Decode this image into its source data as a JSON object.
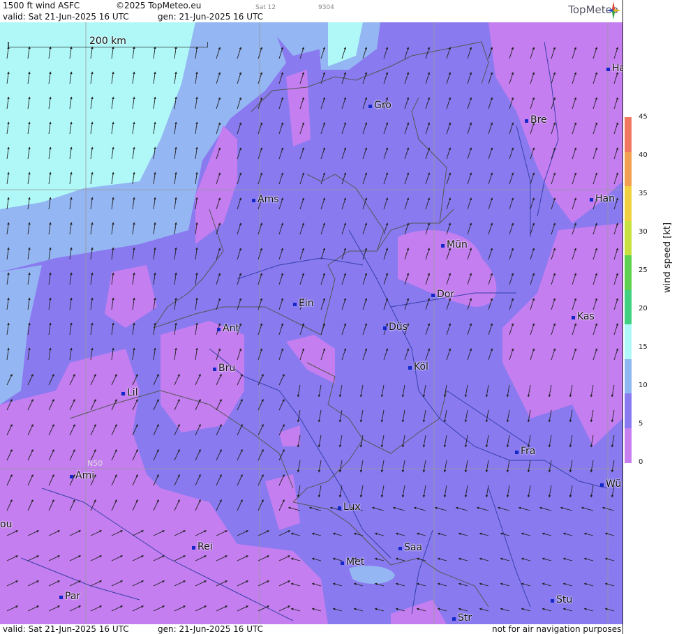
{
  "header": {
    "title": "1500 ft wind ASFC",
    "copyright": "©2025 TopMeteo.eu",
    "valid": "valid:  Sat  21-Jun-2025  16 UTC",
    "generated": "gen: 21-Jun-2025 16 UTC",
    "run_label": "Sat 12",
    "code": "9304",
    "logo": "TopMeteo"
  },
  "footer": {
    "valid": "valid:  Sat  21-Jun-2025  16 UTC",
    "generated": "gen: 21-Jun-2025 16 UTC",
    "disclaimer": "not for air navigation purposes"
  },
  "scale": {
    "label": "200 km"
  },
  "grid": {
    "lat_label": "N50"
  },
  "legend": {
    "title": "wind  speed  [kt]",
    "ticks": [
      "45",
      "40",
      "35",
      "30",
      "25",
      "20",
      "15",
      "10",
      "5",
      "0"
    ],
    "colors": [
      "#f07860",
      "#f0a050",
      "#f0d040",
      "#c8e040",
      "#60d050",
      "#40d080",
      "#b0f8f8",
      "#8fb8f0",
      "#8a7af0",
      "#c880f0"
    ]
  },
  "cities": [
    {
      "name": "Gro"
    },
    {
      "name": "Bre"
    },
    {
      "name": "Ha"
    },
    {
      "name": "Ams"
    },
    {
      "name": "Han"
    },
    {
      "name": "Mün"
    },
    {
      "name": "Ein"
    },
    {
      "name": "Dor"
    },
    {
      "name": "Kas"
    },
    {
      "name": "Ant"
    },
    {
      "name": "Düs"
    },
    {
      "name": "Bru"
    },
    {
      "name": "Köl"
    },
    {
      "name": "Lil"
    },
    {
      "name": "Fra"
    },
    {
      "name": "Ami"
    },
    {
      "name": "Wü"
    },
    {
      "name": "Lux"
    },
    {
      "name": "ou"
    },
    {
      "name": "Saa"
    },
    {
      "name": "Rei"
    },
    {
      "name": "Met"
    },
    {
      "name": "Par"
    },
    {
      "name": "Stu"
    },
    {
      "name": "Str"
    }
  ]
}
